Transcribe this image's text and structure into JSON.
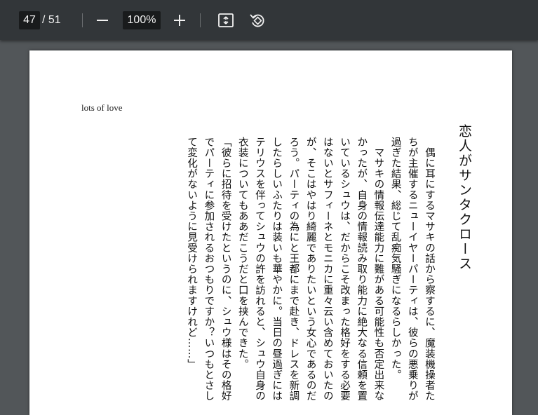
{
  "toolbar": {
    "current_page": "47",
    "page_separator": "/ 51",
    "zoom_level": "100%",
    "zoom_out_icon": "minus-icon",
    "zoom_in_icon": "plus-icon",
    "fit_icon": "fit-to-page-icon",
    "rotate_icon": "rotate-counterclockwise-icon"
  },
  "document": {
    "header_label": "lots of love",
    "chapter_title": "恋人がサンタクロース",
    "body": "　偶に耳にするマサキの話から察するに、魔装機操者たちが主催するニューイヤーパーティは、彼らの悪乗りが過ぎた結果、総じて乱痴気騒ぎになるらしかった。\n　マサキの情報伝達能力に難がある可能性も否定出来なかったが、自身の情報読み取り能力に絶大なる信頼を置いているシュウは、だからこそ改まった格好をする必要はないとサフィーネとモニカに重々云い含めておいたのが、そこはやはり綺麗でありたいという女心であるのだろう。パーティの為にと王都にまで赴き、ドレスを新調したらしいふたりは装いも華やかに。当日の昼過ぎにはテリウスを伴ってシュウの許を訪れると、シュウ自身の衣装についてもああだこうだと口を挟んできた。\n「彼らに招待を受けたというのに、シュウ様はその格好でパーティに参加されるおつもりですか？いつもとさして変化がないように見受けられますけれど……」"
  }
}
